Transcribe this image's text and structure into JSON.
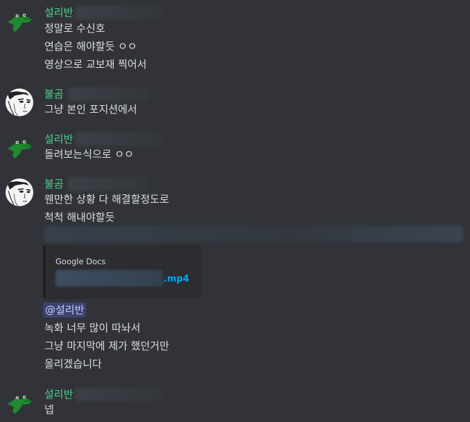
{
  "messages": [
    {
      "author": "설리반",
      "avatar": "crocodile-avatar",
      "lines": [
        "정말로 수신호",
        "연습은 해야할듯 ㅇㅇ",
        "영상으로 교보재 찍어서"
      ]
    },
    {
      "author": "불곰",
      "avatar": "manga-face-avatar",
      "lines": [
        "그냥 본인 포지션에서"
      ]
    },
    {
      "author": "설리반",
      "avatar": "crocodile-avatar",
      "lines": [
        "돌려보는식으로 ㅇㅇ"
      ]
    },
    {
      "author": "불곰",
      "avatar": "manga-face-avatar",
      "lines": [
        "웬만한 상황 다 해결할정도로",
        "척척 해내야할듯"
      ],
      "embed": {
        "provider": "Google Docs",
        "file_ext": ".mp4"
      },
      "mention": "@설리반",
      "lines_after": [
        "녹화 너무 많이 따놔서",
        "그냥 마지막에 제가 했던거만",
        "올리겠습니다"
      ]
    },
    {
      "author": "설리반",
      "avatar": "crocodile-avatar",
      "lines": [
        "넵"
      ]
    }
  ],
  "colors": {
    "background": "#313338",
    "username": "#4fd18b",
    "text": "#dbdee1",
    "link": "#00a8fc",
    "mention_bg": "#3c4270"
  }
}
